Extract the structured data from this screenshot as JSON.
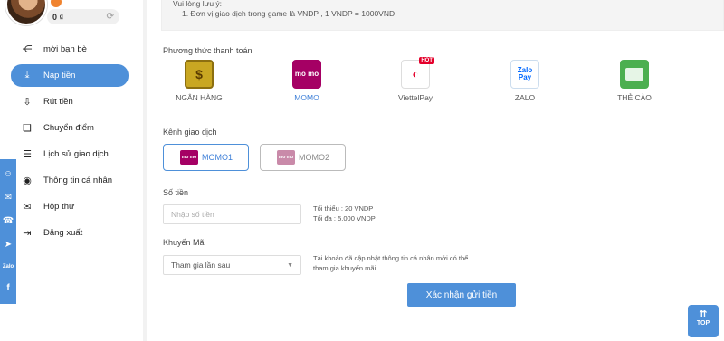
{
  "sidebar": {
    "balance": "0 ₫",
    "items": [
      {
        "label": "mời bạn bè",
        "icon": "share-icon",
        "glyph": "⋲"
      },
      {
        "label": "Nạp tiền",
        "icon": "deposit-icon",
        "glyph": "⤓",
        "active": true
      },
      {
        "label": "Rút tiền",
        "icon": "withdraw-icon",
        "glyph": "⇩"
      },
      {
        "label": "Chuyển điểm",
        "icon": "transfer-icon",
        "glyph": "❏"
      },
      {
        "label": "Lịch sử giao dịch",
        "icon": "history-icon",
        "glyph": "☰"
      },
      {
        "label": "Thông tin cá nhân",
        "icon": "user-icon",
        "glyph": "◉"
      },
      {
        "label": "Hộp thư",
        "icon": "mail-icon",
        "glyph": "✉"
      },
      {
        "label": "Đăng xuất",
        "icon": "logout-icon",
        "glyph": "⇥"
      }
    ]
  },
  "social": [
    "chat-icon",
    "mail-icon",
    "phone-icon",
    "telegram-icon",
    "zalo-icon",
    "facebook-icon"
  ],
  "notice": {
    "title": "Vui lòng lưu ý:",
    "line1": "1. Đơn vị giao dịch trong game là VNDP , 1 VNDP = 1000VND"
  },
  "payment": {
    "title": "Phương thức thanh toán",
    "methods": [
      {
        "label": "NGÂN HÀNG",
        "icon": "bank-icon"
      },
      {
        "label": "MOMO",
        "icon": "momo-icon",
        "active": true,
        "logo_text": "mo mo"
      },
      {
        "label": "ViettelPay",
        "icon": "viettelpay-icon",
        "badge": "HOT"
      },
      {
        "label": "ZALO",
        "icon": "zalopay-icon",
        "logo_text": "Zalo Pay"
      },
      {
        "label": "THẺ CÀO",
        "icon": "card-icon"
      }
    ]
  },
  "channel": {
    "title": "Kênh giao dịch",
    "options": [
      {
        "label": "MOMO1",
        "active": true
      },
      {
        "label": "MOMO2",
        "active": false
      }
    ]
  },
  "amount": {
    "title": "Số tiền",
    "placeholder": "Nhập số tiền",
    "min": "Tối thiểu : 20 VNDP",
    "max": "Tối đa : 5.000 VNDP"
  },
  "promo": {
    "title": "Khuyến Mãi",
    "selected": "Tham gia lần sau",
    "note1": "Tài khoản đã cập nhật thông tin cá nhân mới có thể",
    "note2": "tham gia khuyến mãi"
  },
  "submit_label": "Xác nhận gửi tiền",
  "top_label": "TOP",
  "colors": {
    "accent": "#4e90d9",
    "momo": "#a50064"
  }
}
